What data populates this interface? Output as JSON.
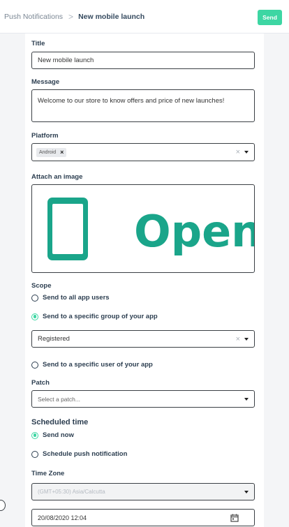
{
  "breadcrumb": {
    "parent": "Push Notifications",
    "separator": ">",
    "current": "New mobile launch"
  },
  "toolbar": {
    "send_label": "Send"
  },
  "form": {
    "title": {
      "label": "Title",
      "value": "New mobile launch"
    },
    "message": {
      "label": "Message",
      "value": "Welcome to our store  to know offers and price of new launches!"
    },
    "platform": {
      "label": "Platform",
      "tags": [
        "Android"
      ],
      "clear": "×",
      "tag_remove": "×"
    },
    "image": {
      "label": "Attach an image",
      "text": "Open",
      "icon": "mobile-phone-icon",
      "color": "#1aa58a"
    },
    "scope": {
      "label": "Scope",
      "options": [
        {
          "label": "Send to all app users",
          "selected": false
        },
        {
          "label": "Send to a specific group of your app",
          "selected": true
        },
        {
          "label": "Send to a specific user of your app",
          "selected": false
        }
      ],
      "group_value": "Registered",
      "clear": "×"
    },
    "patch": {
      "label": "Patch",
      "placeholder": "Select a patch..."
    },
    "schedule": {
      "title": "Scheduled time",
      "options": [
        {
          "label": "Send now",
          "selected": true
        },
        {
          "label": "Schedule push notification",
          "selected": false
        }
      ]
    },
    "timezone": {
      "label": "Time Zone",
      "value": "(GMT+05:30) Asia/Calcutta"
    },
    "datetime": {
      "value": "20/08/2020 12:04"
    }
  },
  "colors": {
    "accent": "#3dd6a3",
    "text": "#2c3e50",
    "border": "#3a3f44"
  }
}
